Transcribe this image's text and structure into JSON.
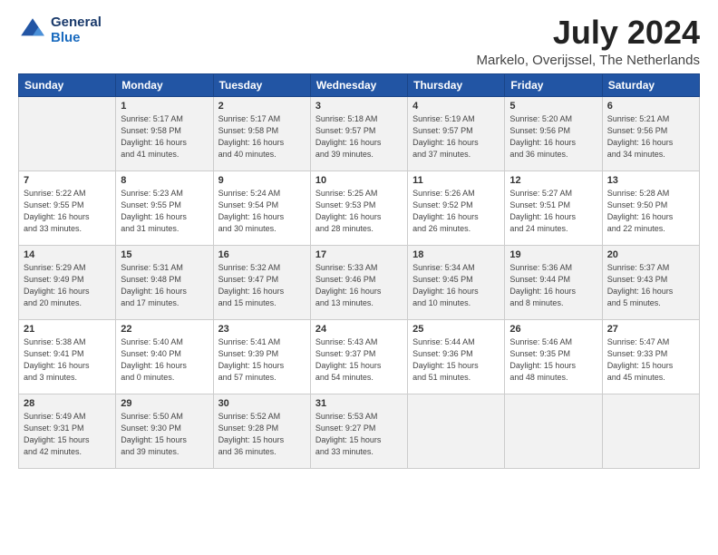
{
  "logo": {
    "line1": "General",
    "line2": "Blue"
  },
  "title": "July 2024",
  "subtitle": "Markelo, Overijssel, The Netherlands",
  "headers": [
    "Sunday",
    "Monday",
    "Tuesday",
    "Wednesday",
    "Thursday",
    "Friday",
    "Saturday"
  ],
  "weeks": [
    [
      {
        "day": "",
        "info": ""
      },
      {
        "day": "1",
        "info": "Sunrise: 5:17 AM\nSunset: 9:58 PM\nDaylight: 16 hours\nand 41 minutes."
      },
      {
        "day": "2",
        "info": "Sunrise: 5:17 AM\nSunset: 9:58 PM\nDaylight: 16 hours\nand 40 minutes."
      },
      {
        "day": "3",
        "info": "Sunrise: 5:18 AM\nSunset: 9:57 PM\nDaylight: 16 hours\nand 39 minutes."
      },
      {
        "day": "4",
        "info": "Sunrise: 5:19 AM\nSunset: 9:57 PM\nDaylight: 16 hours\nand 37 minutes."
      },
      {
        "day": "5",
        "info": "Sunrise: 5:20 AM\nSunset: 9:56 PM\nDaylight: 16 hours\nand 36 minutes."
      },
      {
        "day": "6",
        "info": "Sunrise: 5:21 AM\nSunset: 9:56 PM\nDaylight: 16 hours\nand 34 minutes."
      }
    ],
    [
      {
        "day": "7",
        "info": "Sunrise: 5:22 AM\nSunset: 9:55 PM\nDaylight: 16 hours\nand 33 minutes."
      },
      {
        "day": "8",
        "info": "Sunrise: 5:23 AM\nSunset: 9:55 PM\nDaylight: 16 hours\nand 31 minutes."
      },
      {
        "day": "9",
        "info": "Sunrise: 5:24 AM\nSunset: 9:54 PM\nDaylight: 16 hours\nand 30 minutes."
      },
      {
        "day": "10",
        "info": "Sunrise: 5:25 AM\nSunset: 9:53 PM\nDaylight: 16 hours\nand 28 minutes."
      },
      {
        "day": "11",
        "info": "Sunrise: 5:26 AM\nSunset: 9:52 PM\nDaylight: 16 hours\nand 26 minutes."
      },
      {
        "day": "12",
        "info": "Sunrise: 5:27 AM\nSunset: 9:51 PM\nDaylight: 16 hours\nand 24 minutes."
      },
      {
        "day": "13",
        "info": "Sunrise: 5:28 AM\nSunset: 9:50 PM\nDaylight: 16 hours\nand 22 minutes."
      }
    ],
    [
      {
        "day": "14",
        "info": "Sunrise: 5:29 AM\nSunset: 9:49 PM\nDaylight: 16 hours\nand 20 minutes."
      },
      {
        "day": "15",
        "info": "Sunrise: 5:31 AM\nSunset: 9:48 PM\nDaylight: 16 hours\nand 17 minutes."
      },
      {
        "day": "16",
        "info": "Sunrise: 5:32 AM\nSunset: 9:47 PM\nDaylight: 16 hours\nand 15 minutes."
      },
      {
        "day": "17",
        "info": "Sunrise: 5:33 AM\nSunset: 9:46 PM\nDaylight: 16 hours\nand 13 minutes."
      },
      {
        "day": "18",
        "info": "Sunrise: 5:34 AM\nSunset: 9:45 PM\nDaylight: 16 hours\nand 10 minutes."
      },
      {
        "day": "19",
        "info": "Sunrise: 5:36 AM\nSunset: 9:44 PM\nDaylight: 16 hours\nand 8 minutes."
      },
      {
        "day": "20",
        "info": "Sunrise: 5:37 AM\nSunset: 9:43 PM\nDaylight: 16 hours\nand 5 minutes."
      }
    ],
    [
      {
        "day": "21",
        "info": "Sunrise: 5:38 AM\nSunset: 9:41 PM\nDaylight: 16 hours\nand 3 minutes."
      },
      {
        "day": "22",
        "info": "Sunrise: 5:40 AM\nSunset: 9:40 PM\nDaylight: 16 hours\nand 0 minutes."
      },
      {
        "day": "23",
        "info": "Sunrise: 5:41 AM\nSunset: 9:39 PM\nDaylight: 15 hours\nand 57 minutes."
      },
      {
        "day": "24",
        "info": "Sunrise: 5:43 AM\nSunset: 9:37 PM\nDaylight: 15 hours\nand 54 minutes."
      },
      {
        "day": "25",
        "info": "Sunrise: 5:44 AM\nSunset: 9:36 PM\nDaylight: 15 hours\nand 51 minutes."
      },
      {
        "day": "26",
        "info": "Sunrise: 5:46 AM\nSunset: 9:35 PM\nDaylight: 15 hours\nand 48 minutes."
      },
      {
        "day": "27",
        "info": "Sunrise: 5:47 AM\nSunset: 9:33 PM\nDaylight: 15 hours\nand 45 minutes."
      }
    ],
    [
      {
        "day": "28",
        "info": "Sunrise: 5:49 AM\nSunset: 9:31 PM\nDaylight: 15 hours\nand 42 minutes."
      },
      {
        "day": "29",
        "info": "Sunrise: 5:50 AM\nSunset: 9:30 PM\nDaylight: 15 hours\nand 39 minutes."
      },
      {
        "day": "30",
        "info": "Sunrise: 5:52 AM\nSunset: 9:28 PM\nDaylight: 15 hours\nand 36 minutes."
      },
      {
        "day": "31",
        "info": "Sunrise: 5:53 AM\nSunset: 9:27 PM\nDaylight: 15 hours\nand 33 minutes."
      },
      {
        "day": "",
        "info": ""
      },
      {
        "day": "",
        "info": ""
      },
      {
        "day": "",
        "info": ""
      }
    ]
  ]
}
